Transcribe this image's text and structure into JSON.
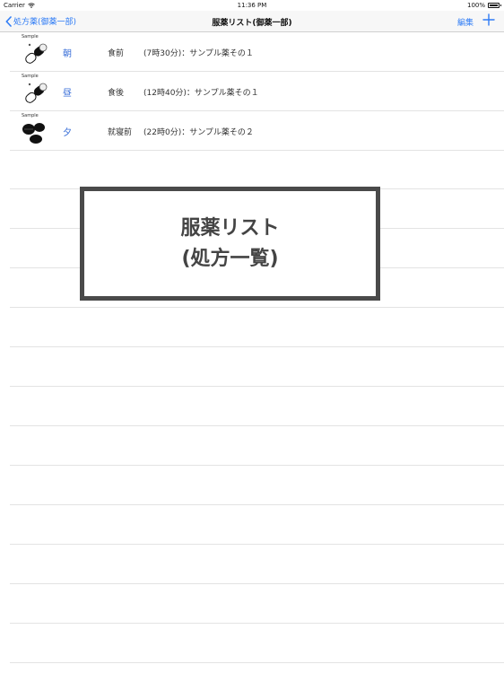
{
  "status_bar": {
    "carrier": "Carrier",
    "time": "11:36 PM",
    "battery": "100%"
  },
  "nav": {
    "back_label": "処方薬(御薬一部)",
    "title": "服薬リスト(御薬一部)",
    "edit_label": "編集",
    "add_icon": "plus-icon",
    "accent_color": "#2f7cf6"
  },
  "rows": [
    {
      "image_label": "Sample",
      "image_type": "capsule",
      "time_of_day": "朝",
      "timing": "食前",
      "detail": "(7時30分)：サンプル薬その１"
    },
    {
      "image_label": "Sample",
      "image_type": "capsule",
      "time_of_day": "昼",
      "timing": "食後",
      "detail": "(12時40分)：サンプル薬その１"
    },
    {
      "image_label": "Sample",
      "image_type": "tablets",
      "time_of_day": "夕",
      "timing": "就寝前",
      "detail": "(22時0分)：サンプル薬その２"
    }
  ],
  "overlay": {
    "line1": "服薬リスト",
    "line2": "(処方一覧)"
  }
}
